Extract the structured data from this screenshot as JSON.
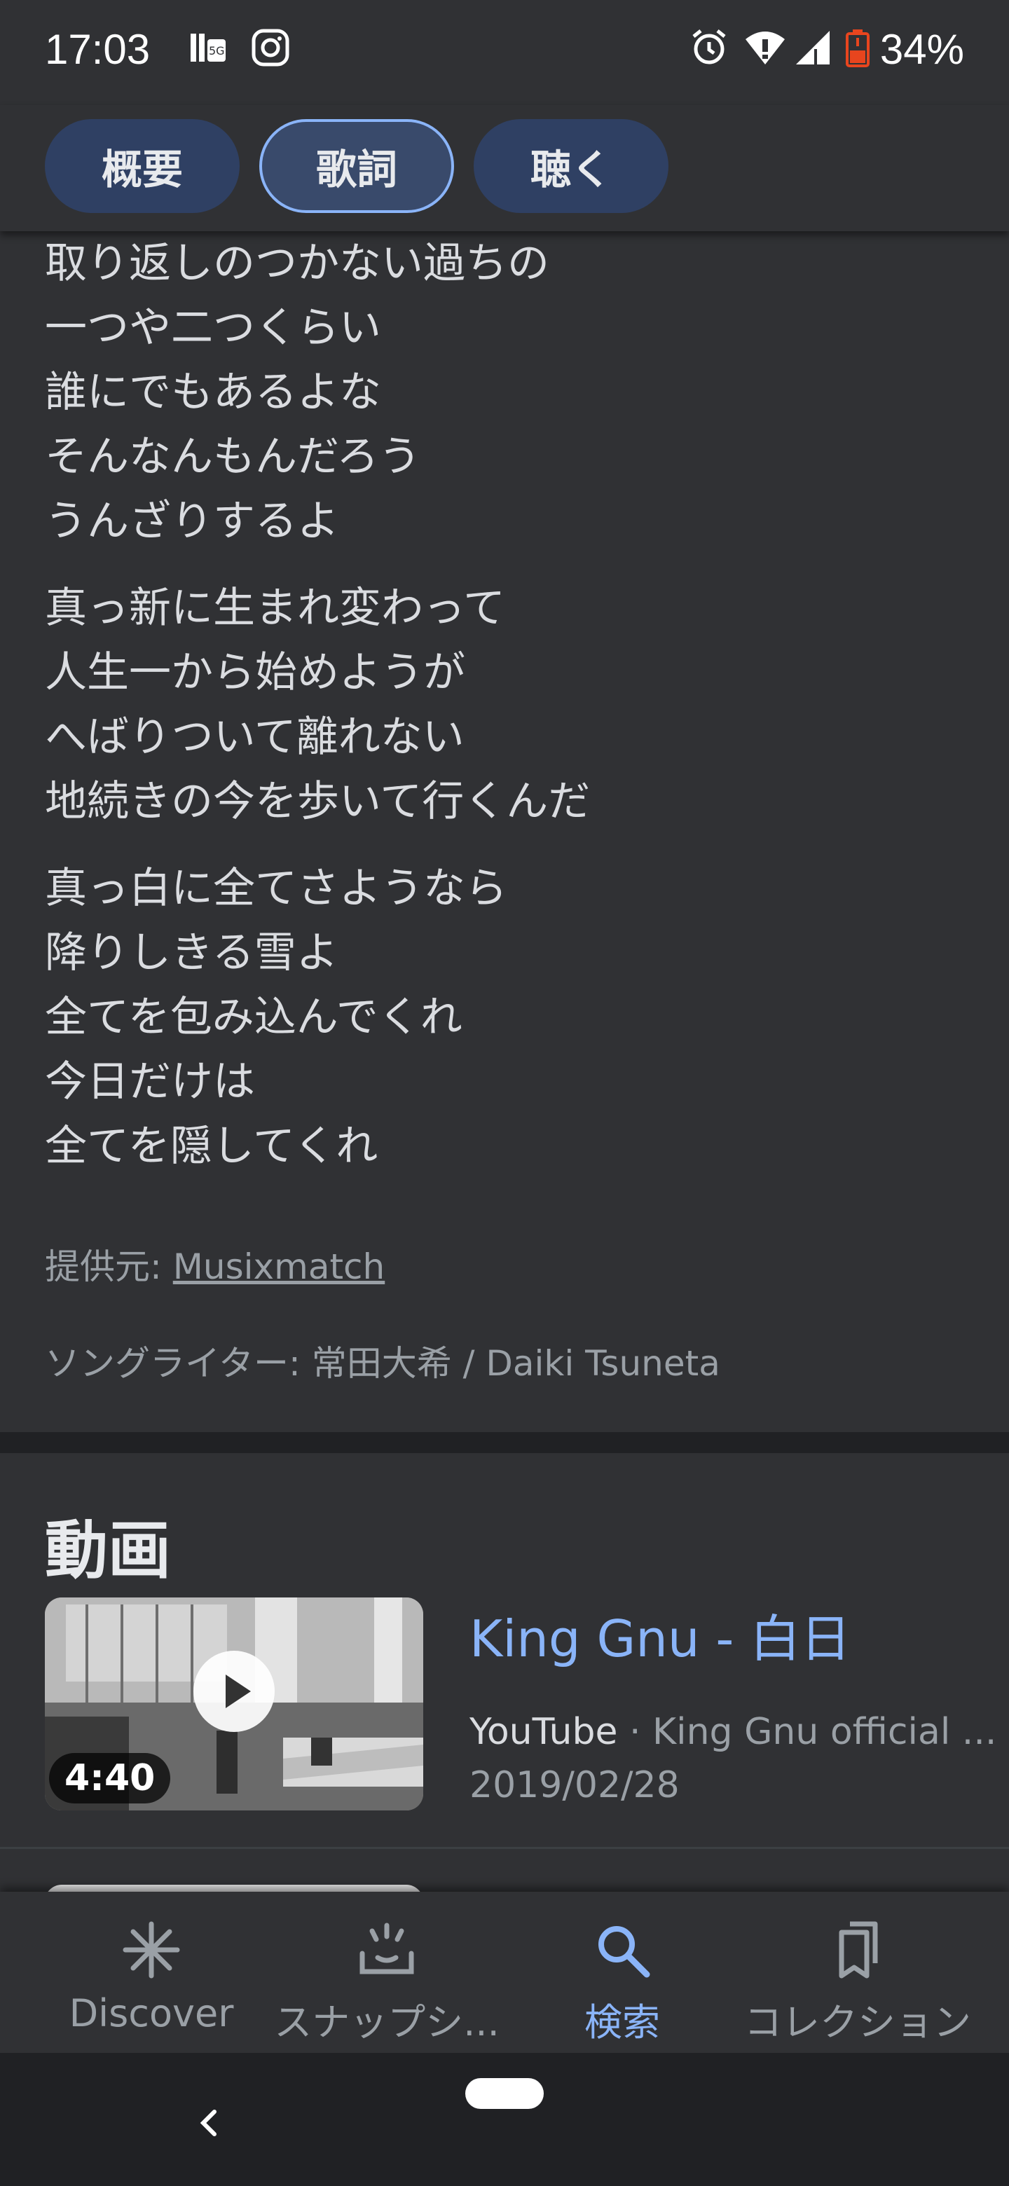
{
  "status_bar": {
    "time": "17:03",
    "battery": "34%",
    "icons": [
      "signal-4g-icon",
      "instagram-icon",
      "alarm-icon",
      "wifi-icon",
      "cell-signal-icon",
      "battery-low-icon"
    ]
  },
  "tabs": [
    {
      "label": "概要",
      "active": false
    },
    {
      "label": "歌詞",
      "active": true
    },
    {
      "label": "聴く",
      "active": false
    }
  ],
  "lyrics": {
    "stanzas": [
      [
        "取り返しのつかない過ちの",
        "一つや二つくらい",
        "誰にでもあるよな",
        "そんなんもんだろう",
        "うんざりするよ"
      ],
      [
        "真っ新に生まれ変わって",
        "人生一から始めようが",
        "へばりついて離れない",
        "地続きの今を歩いて行くんだ"
      ],
      [
        "真っ白に全てさようなら",
        "降りしきる雪よ",
        "全てを包み込んでくれ",
        "今日だけは",
        "全てを隠してくれ"
      ]
    ],
    "source_prefix": "提供元: ",
    "source_name": "Musixmatch",
    "songwriter": "ソングライター: 常田大希 / Daiki Tsuneta"
  },
  "videos": {
    "heading": "動画",
    "items": [
      {
        "title": "King Gnu - 白日",
        "duration": "4:40",
        "platform": "YouTube",
        "separator": " · ",
        "channel": "King Gnu official ...",
        "date": "2019/02/28"
      }
    ]
  },
  "bottom_nav": [
    {
      "label": "Discover",
      "icon": "asterisk-icon",
      "active": false
    },
    {
      "label": "スナップシ...",
      "icon": "snapshot-icon",
      "active": false
    },
    {
      "label": "検索",
      "icon": "search-icon",
      "active": true
    },
    {
      "label": "コレクション",
      "icon": "bookmarks-icon",
      "active": false
    }
  ],
  "colors": {
    "background": "#303134",
    "accent": "#8ab4f8",
    "chip": "#2f4063",
    "text_secondary": "#9aa0a6"
  }
}
